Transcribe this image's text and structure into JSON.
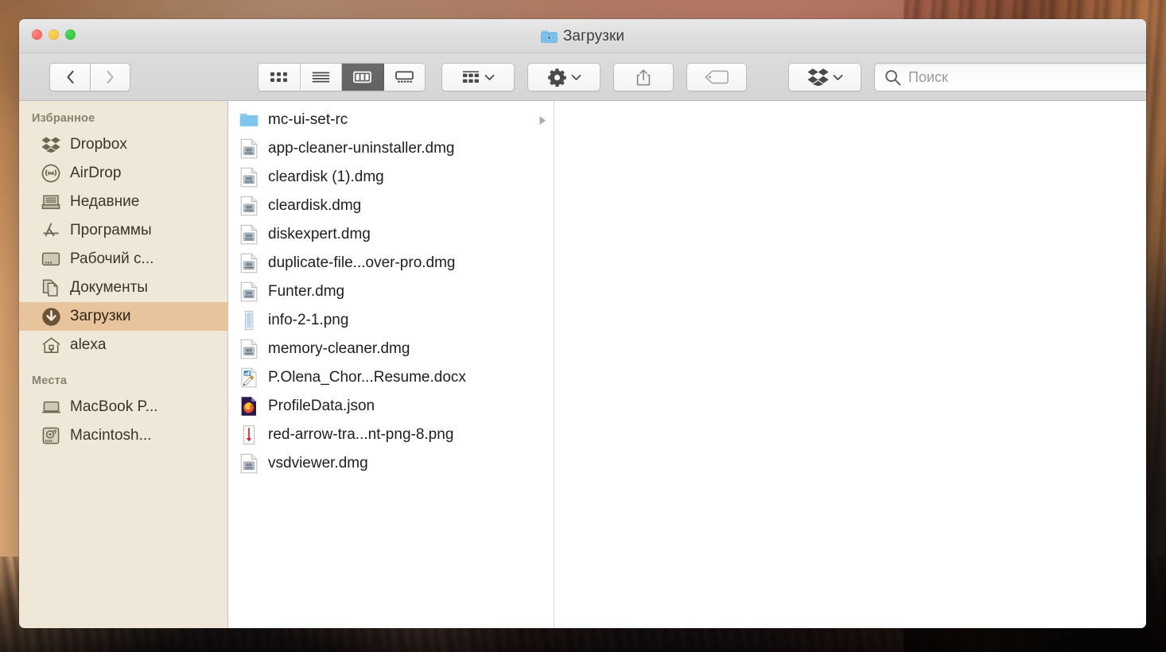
{
  "window": {
    "title": "Загрузки",
    "title_icon": "downloads-folder-icon",
    "traffic_lights": [
      {
        "name": "close-button",
        "color": "#f9564e"
      },
      {
        "name": "minimize-button",
        "color": "#f6bb2e"
      },
      {
        "name": "maximize-button",
        "color": "#22c331"
      }
    ]
  },
  "toolbar": {
    "back_label": "back-chevron-icon",
    "forward_label": "forward-chevron-icon",
    "view_modes": [
      {
        "name": "icon-view",
        "icon": "grid-icon",
        "active": false
      },
      {
        "name": "list-view",
        "icon": "list-lines-icon",
        "active": false
      },
      {
        "name": "column-view",
        "icon": "columns-icon",
        "active": true
      },
      {
        "name": "gallery-view",
        "icon": "gallery-icon",
        "active": false
      }
    ],
    "arrange_icon": "arrange-grid-icon",
    "action_icon": "gear-icon",
    "share_icon": "share-icon",
    "tags_icon": "tag-icon",
    "dropbox_icon": "dropbox-icon",
    "dropdown_icon": "chevron-down-icon"
  },
  "search": {
    "icon": "search-icon",
    "placeholder": "Поиск",
    "value": ""
  },
  "sidebar": {
    "groups": [
      {
        "header": "Избранное",
        "items": [
          {
            "label": "Dropbox",
            "icon": "dropbox-icon",
            "selected": false
          },
          {
            "label": "AirDrop",
            "icon": "airdrop-icon",
            "selected": false
          },
          {
            "label": "Недавние",
            "icon": "recents-icon",
            "selected": false
          },
          {
            "label": "Программы",
            "icon": "appstore-icon",
            "selected": false
          },
          {
            "label": "Рабочий с...",
            "icon": "desktop-icon",
            "selected": false
          },
          {
            "label": "Документы",
            "icon": "documents-icon",
            "selected": false
          },
          {
            "label": "Загрузки",
            "icon": "downloads-icon",
            "selected": true
          },
          {
            "label": "alexa",
            "icon": "home-icon",
            "selected": false
          }
        ]
      },
      {
        "header": "Места",
        "items": [
          {
            "label": "MacBook P...",
            "icon": "laptop-icon",
            "selected": false
          },
          {
            "label": "Macintosh...",
            "icon": "harddisk-icon",
            "selected": false
          }
        ]
      }
    ],
    "selection_color": "#e8c49c",
    "background_color": "#eee6d6"
  },
  "file_list": [
    {
      "name": "mc-ui-set-rc",
      "icon": "folder-icon",
      "has_children": true
    },
    {
      "name": "app-cleaner-uninstaller.dmg",
      "icon": "dmg-icon",
      "has_children": false
    },
    {
      "name": "cleardisk (1).dmg",
      "icon": "dmg-icon",
      "has_children": false
    },
    {
      "name": "cleardisk.dmg",
      "icon": "dmg-icon",
      "has_children": false
    },
    {
      "name": "diskexpert.dmg",
      "icon": "dmg-icon",
      "has_children": false
    },
    {
      "name": "duplicate-file...over-pro.dmg",
      "icon": "dmg-icon",
      "has_children": false
    },
    {
      "name": "Funter.dmg",
      "icon": "dmg-icon",
      "has_children": false
    },
    {
      "name": "info-2-1.png",
      "icon": "png-icon",
      "has_children": false
    },
    {
      "name": "memory-cleaner.dmg",
      "icon": "dmg-icon",
      "has_children": false
    },
    {
      "name": "P.Olena_Chor...Resume.docx",
      "icon": "docx-icon",
      "has_children": false
    },
    {
      "name": "ProfileData.json",
      "icon": "firefox-icon",
      "has_children": false
    },
    {
      "name": "red-arrow-tra...nt-png-8.png",
      "icon": "redarrow-png-icon",
      "has_children": false
    },
    {
      "name": "vsdviewer.dmg",
      "icon": "dmg-icon",
      "has_children": false
    }
  ]
}
